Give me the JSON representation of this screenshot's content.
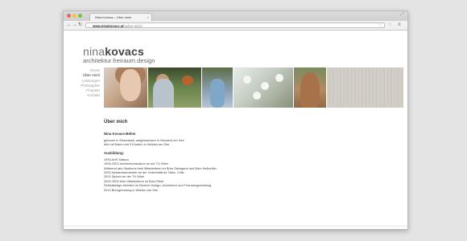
{
  "browser": {
    "tab_title": "Nina Kovacs – Über mich",
    "tab_close": "×",
    "url_domain": "www.ninakovacs.at",
    "url_path": "/ueber-mich/",
    "icons": [
      "back-arrow-icon",
      "forward-arrow-icon",
      "reload-icon",
      "lock-icon",
      "star-icon",
      "extension-icon",
      "menu-icon"
    ]
  },
  "site": {
    "logo_part1": "nina",
    "logo_part2": "kovacs",
    "tagline": "architektur.freiraum.design"
  },
  "nav": {
    "items": [
      {
        "label": "Home"
      },
      {
        "label": "Über mich"
      },
      {
        "label": "Leistungen"
      },
      {
        "label": "Philosophie"
      },
      {
        "label": "Projekte"
      },
      {
        "label": "Kontakt"
      }
    ],
    "active_index": 1
  },
  "main": {
    "heading": "Über mich",
    "name": "Nina Kovacs-Böhm",
    "bio": [
      "geboren in Eisenstadt, aufgewachsen in Neusiedl am See",
      "lebt mit Mann und 3 Kindern in Weiden am See"
    ],
    "education_heading": "Ausbildung:",
    "education": [
      "1993 AHS Matura",
      "1993-2001 Architekturstudium an der TU Wien",
      "Während des Studiums freie Mitarbeiterin im Büro Steingartz und Büro Hellmüller",
      "2000 Auslandssemester an der Universität de Talca, Chile",
      "2001 Diplom an der TU Wien",
      "2002-2005 freie Mitarbeiterin im Büro Riedl",
      "Selbständige Arbeiten im Bereich Design, Architektur und Freiraumgestaltung",
      "2013 Bürogründung in Weiden am See"
    ]
  },
  "colors": {
    "text": "#333333",
    "nav_inactive": "#999999",
    "background": "#ffffff"
  }
}
